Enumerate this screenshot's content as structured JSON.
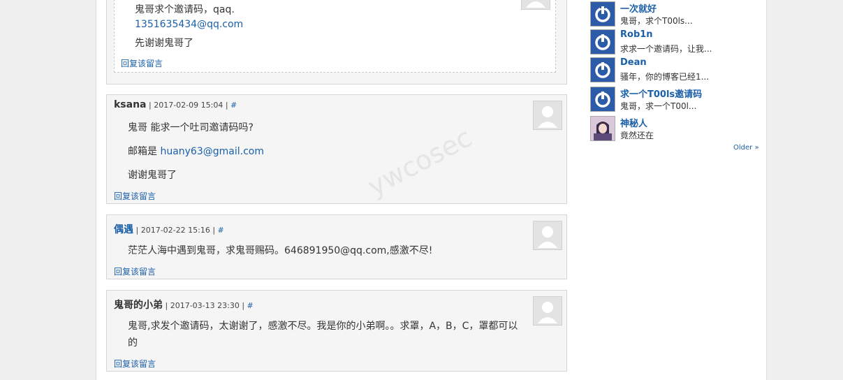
{
  "top_reply": {
    "lines": [
      "鬼哥求个邀请码，qaq.",
      "1351635434@qq.com",
      "先谢谢鬼哥了"
    ],
    "reply_label": "回复该留言"
  },
  "comments": [
    {
      "author": "ksana",
      "meta": " | 2017-02-09 15:04 | ",
      "hash": "#",
      "lines": [
        "鬼哥 能求一个吐司邀请码吗?",
        "邮箱是 ",
        "谢谢鬼哥了"
      ],
      "email": "huany63@gmail.com",
      "reply_label": "回复该留言"
    },
    {
      "author": "偶遇",
      "meta": " | 2017-02-22 15:16 | ",
      "hash": "#",
      "lines": [
        "茫茫人海中遇到鬼哥，求鬼哥赐码。646891950@qq.com,感激不尽!"
      ],
      "reply_label": "回复该留言"
    },
    {
      "author": "鬼哥的小弟",
      "meta": " | 2017-03-13 23:30 | ",
      "hash": "#",
      "lines": [
        "鬼哥,求发个邀请码，太谢谢了，感激不尽。我是你的小弟啊。。求罩，A，B，C，罩都可以",
        "的"
      ],
      "reply_label": "回复该留言"
    }
  ],
  "sidebar": {
    "recent": [
      {
        "name": "一次就好",
        "text": "鬼哥，求个T00ls..."
      },
      {
        "name": "Rob1n",
        "text": "求求一个邀请码，让我..."
      },
      {
        "name": "Dean",
        "text": "骚年，你的博客已经1..."
      },
      {
        "name": "求一个T00ls邀请码",
        "text": "鬼哥，求一个T00l..."
      },
      {
        "name": "神秘人",
        "text": "竟然还在"
      }
    ],
    "older_label": "Older »"
  },
  "watermark": "ywcosec",
  "colors": {
    "link": "#1a5fa8",
    "panel_bg": "#f5f5f5",
    "page_bg": "#efefef",
    "sidebar_avatar": "#2c5ba8"
  }
}
